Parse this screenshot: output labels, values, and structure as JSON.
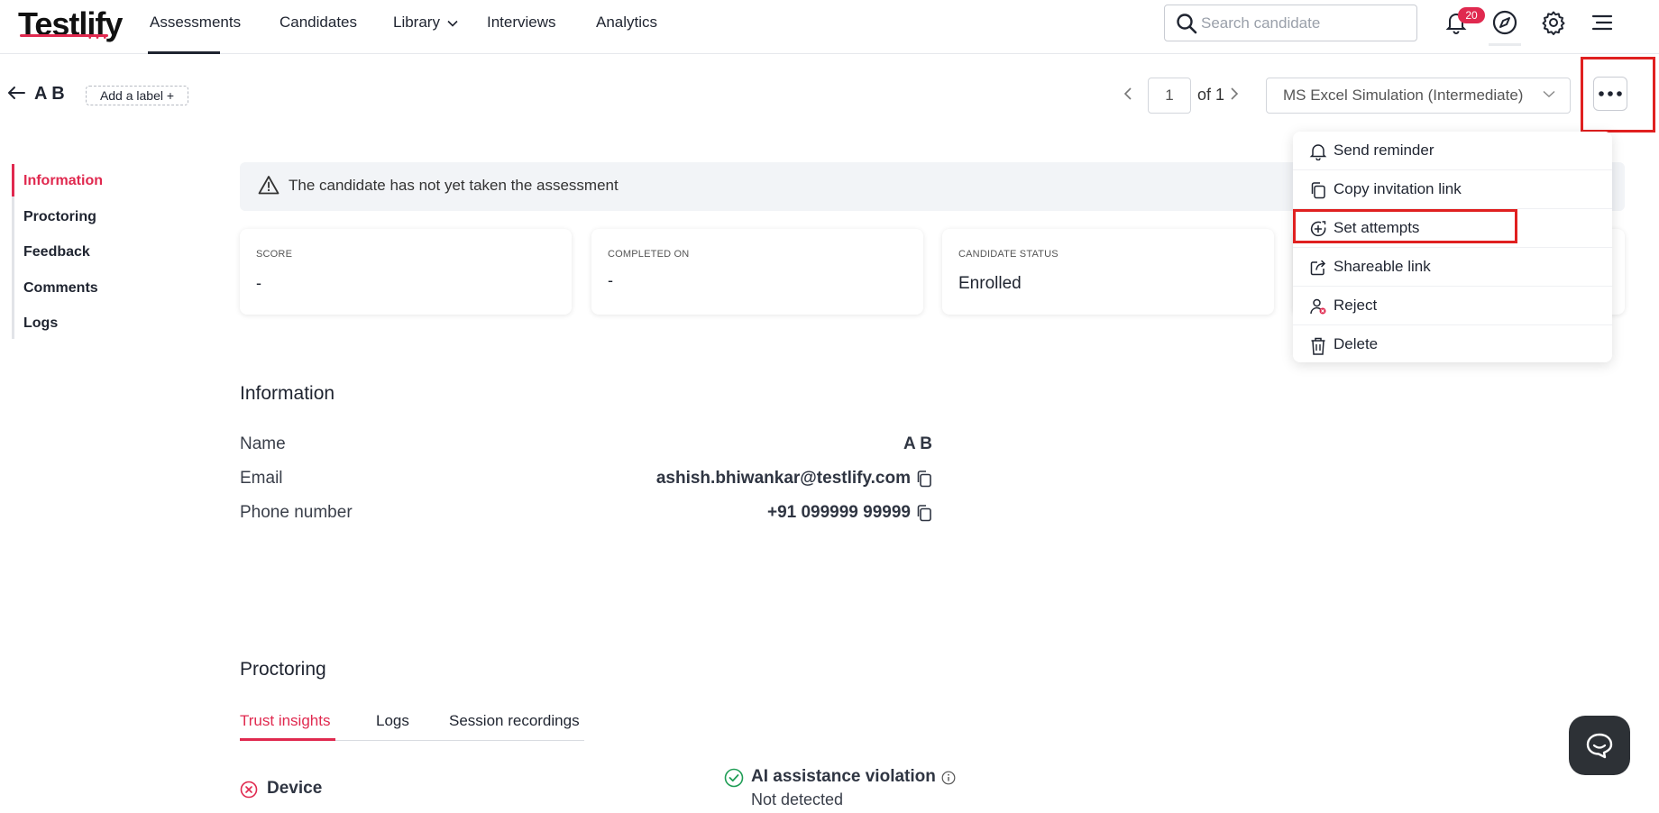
{
  "brand": {
    "logo": "Testlify",
    "accent": "#e0294f"
  },
  "nav": {
    "items": [
      {
        "label": "Assessments",
        "active": true
      },
      {
        "label": "Candidates"
      },
      {
        "label": "Library"
      },
      {
        "label": "Interviews"
      },
      {
        "label": "Analytics"
      }
    ],
    "search_placeholder": "Search candidate",
    "notification_count": "20"
  },
  "candidate": {
    "name": "A B",
    "add_label": "Add a label +",
    "page_current": "1",
    "page_of": "of 1",
    "assessment": "MS Excel Simulation (Intermediate)"
  },
  "side_nav": [
    "Information",
    "Proctoring",
    "Feedback",
    "Comments",
    "Logs"
  ],
  "alert": "The candidate has not yet taken the assessment",
  "stats": [
    {
      "caption": "SCORE",
      "value": "-"
    },
    {
      "caption": "COMPLETED ON",
      "value": "-"
    },
    {
      "caption": "CANDIDATE STATUS",
      "value": "Enrolled"
    }
  ],
  "menu": [
    {
      "label": "Send reminder",
      "icon": "bell-icon"
    },
    {
      "label": "Copy invitation link",
      "icon": "copy-icon"
    },
    {
      "label": "Set attempts",
      "icon": "plus-circle-icon"
    },
    {
      "label": "Shareable link",
      "icon": "share-icon"
    },
    {
      "label": "Reject",
      "icon": "user-reject-icon"
    },
    {
      "label": "Delete",
      "icon": "trash-icon"
    }
  ],
  "information": {
    "title": "Information",
    "rows": [
      {
        "label": "Name",
        "value": "A B"
      },
      {
        "label": "Email",
        "value": "ashish.bhiwankar@testlify.com"
      },
      {
        "label": "Phone number",
        "value": "+91 099999 99999"
      }
    ]
  },
  "proctoring": {
    "title": "Proctoring",
    "tabs": [
      "Trust insights",
      "Logs",
      "Session recordings"
    ],
    "device_label": "Device",
    "ai_title": "AI assistance violation",
    "ai_status": "Not detected"
  }
}
